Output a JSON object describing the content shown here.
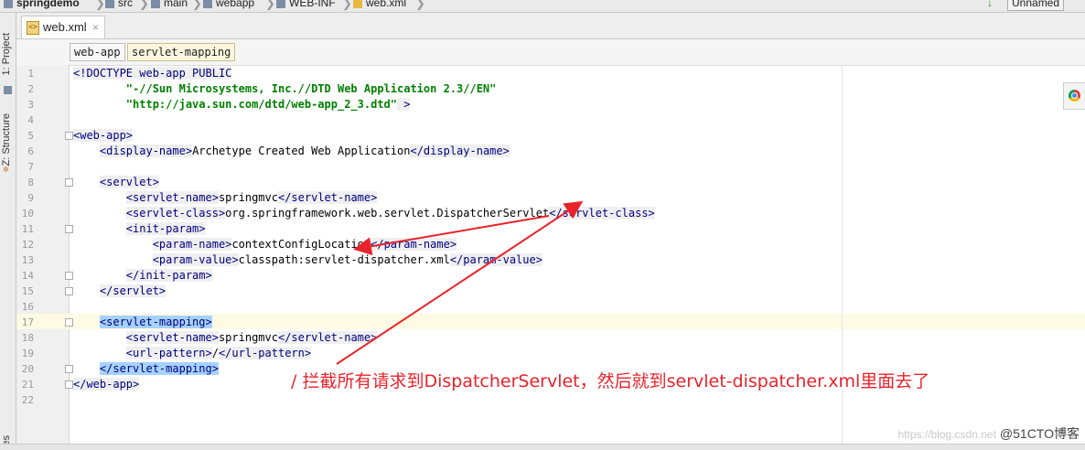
{
  "breadcrumbs": [
    "springdemo",
    "src",
    "main",
    "webapp",
    "WEB-INF",
    "web.xml"
  ],
  "top_right": {
    "run_glyph": "↓",
    "project_label": "Unnamed"
  },
  "side_tabs": {
    "project": "1: Project",
    "structure": "Z: Structure",
    "bottom": "es"
  },
  "tab": {
    "label": "web.xml",
    "close": "×"
  },
  "structure_breadcrumb": [
    "web-app",
    "servlet-mapping"
  ],
  "code_lines": [
    {
      "n": "1",
      "p": [
        {
          "c": "t",
          "x": "<!DOCTYPE web-app PUBLIC"
        }
      ]
    },
    {
      "n": "2",
      "p": [
        {
          "c": "p",
          "x": "        "
        },
        {
          "c": "s",
          "x": "\"-//Sun Microsystems, Inc.//DTD Web Application 2.3//EN\""
        }
      ]
    },
    {
      "n": "3",
      "p": [
        {
          "c": "p",
          "x": "        "
        },
        {
          "c": "s",
          "x": "\"http://java.sun.com/dtd/web-app_2_3.dtd\""
        },
        {
          "c": "t",
          "x": " >"
        }
      ]
    },
    {
      "n": "4",
      "p": []
    },
    {
      "n": "5",
      "p": [
        {
          "c": "t",
          "x": "<web-app>"
        }
      ]
    },
    {
      "n": "6",
      "p": [
        {
          "c": "p",
          "x": "    "
        },
        {
          "c": "t",
          "x": "<display-name>"
        },
        {
          "c": "p",
          "x": "Archetype Created Web Application"
        },
        {
          "c": "t",
          "x": "</display-name>"
        }
      ]
    },
    {
      "n": "7",
      "p": []
    },
    {
      "n": "8",
      "p": [
        {
          "c": "p",
          "x": "    "
        },
        {
          "c": "t",
          "x": "<servlet>"
        }
      ]
    },
    {
      "n": "9",
      "p": [
        {
          "c": "p",
          "x": "        "
        },
        {
          "c": "t",
          "x": "<servlet-name>"
        },
        {
          "c": "p",
          "x": "springmvc"
        },
        {
          "c": "t",
          "x": "</servlet-name>"
        }
      ]
    },
    {
      "n": "10",
      "p": [
        {
          "c": "p",
          "x": "        "
        },
        {
          "c": "t",
          "x": "<servlet-class>"
        },
        {
          "c": "p",
          "x": "org.springframework.web.servlet.DispatcherServlet"
        },
        {
          "c": "t",
          "x": "</servlet-class>"
        }
      ]
    },
    {
      "n": "11",
      "p": [
        {
          "c": "p",
          "x": "        "
        },
        {
          "c": "t",
          "x": "<init-param>"
        }
      ]
    },
    {
      "n": "12",
      "p": [
        {
          "c": "p",
          "x": "            "
        },
        {
          "c": "t",
          "x": "<param-name>"
        },
        {
          "c": "p",
          "x": "contextConfigLocation"
        },
        {
          "c": "t",
          "x": "</param-name>"
        }
      ]
    },
    {
      "n": "13",
      "p": [
        {
          "c": "p",
          "x": "            "
        },
        {
          "c": "t",
          "x": "<param-value>"
        },
        {
          "c": "p",
          "x": "classpath:servlet-dispatcher.xml"
        },
        {
          "c": "t",
          "x": "</param-value>"
        }
      ]
    },
    {
      "n": "14",
      "p": [
        {
          "c": "p",
          "x": "        "
        },
        {
          "c": "t",
          "x": "</init-param>"
        }
      ]
    },
    {
      "n": "15",
      "p": [
        {
          "c": "p",
          "x": "    "
        },
        {
          "c": "t",
          "x": "</servlet>"
        }
      ]
    },
    {
      "n": "16",
      "p": []
    },
    {
      "n": "17",
      "p": [
        {
          "c": "p",
          "x": "    "
        },
        {
          "c": "tsel",
          "x": "<servlet-mapping>"
        }
      ]
    },
    {
      "n": "18",
      "p": [
        {
          "c": "p",
          "x": "        "
        },
        {
          "c": "t",
          "x": "<servlet-name>"
        },
        {
          "c": "p",
          "x": "springmvc"
        },
        {
          "c": "t",
          "x": "</servlet-name>"
        }
      ]
    },
    {
      "n": "19",
      "p": [
        {
          "c": "p",
          "x": "        "
        },
        {
          "c": "t",
          "x": "<url-pattern>"
        },
        {
          "c": "p",
          "x": "/"
        },
        {
          "c": "t",
          "x": "</url-pattern>"
        }
      ]
    },
    {
      "n": "20",
      "p": [
        {
          "c": "p",
          "x": "    "
        },
        {
          "c": "tsel",
          "x": "</servlet-mapping>"
        }
      ]
    },
    {
      "n": "21",
      "p": [
        {
          "c": "t",
          "x": "</web-app>"
        }
      ]
    },
    {
      "n": "22",
      "p": []
    }
  ],
  "annotation": "/ 拦截所有请求到DispatcherServlet，然后就到servlet-dispatcher.xml里面去了",
  "watermark": {
    "left": "https://blog.csdn.net",
    "right": "@51CTO博客"
  },
  "colors": {
    "tag": "#000080",
    "string": "#008000",
    "annotation": "#e8232b",
    "current_line": "#fffae3",
    "selection": "#a6d2ff"
  }
}
